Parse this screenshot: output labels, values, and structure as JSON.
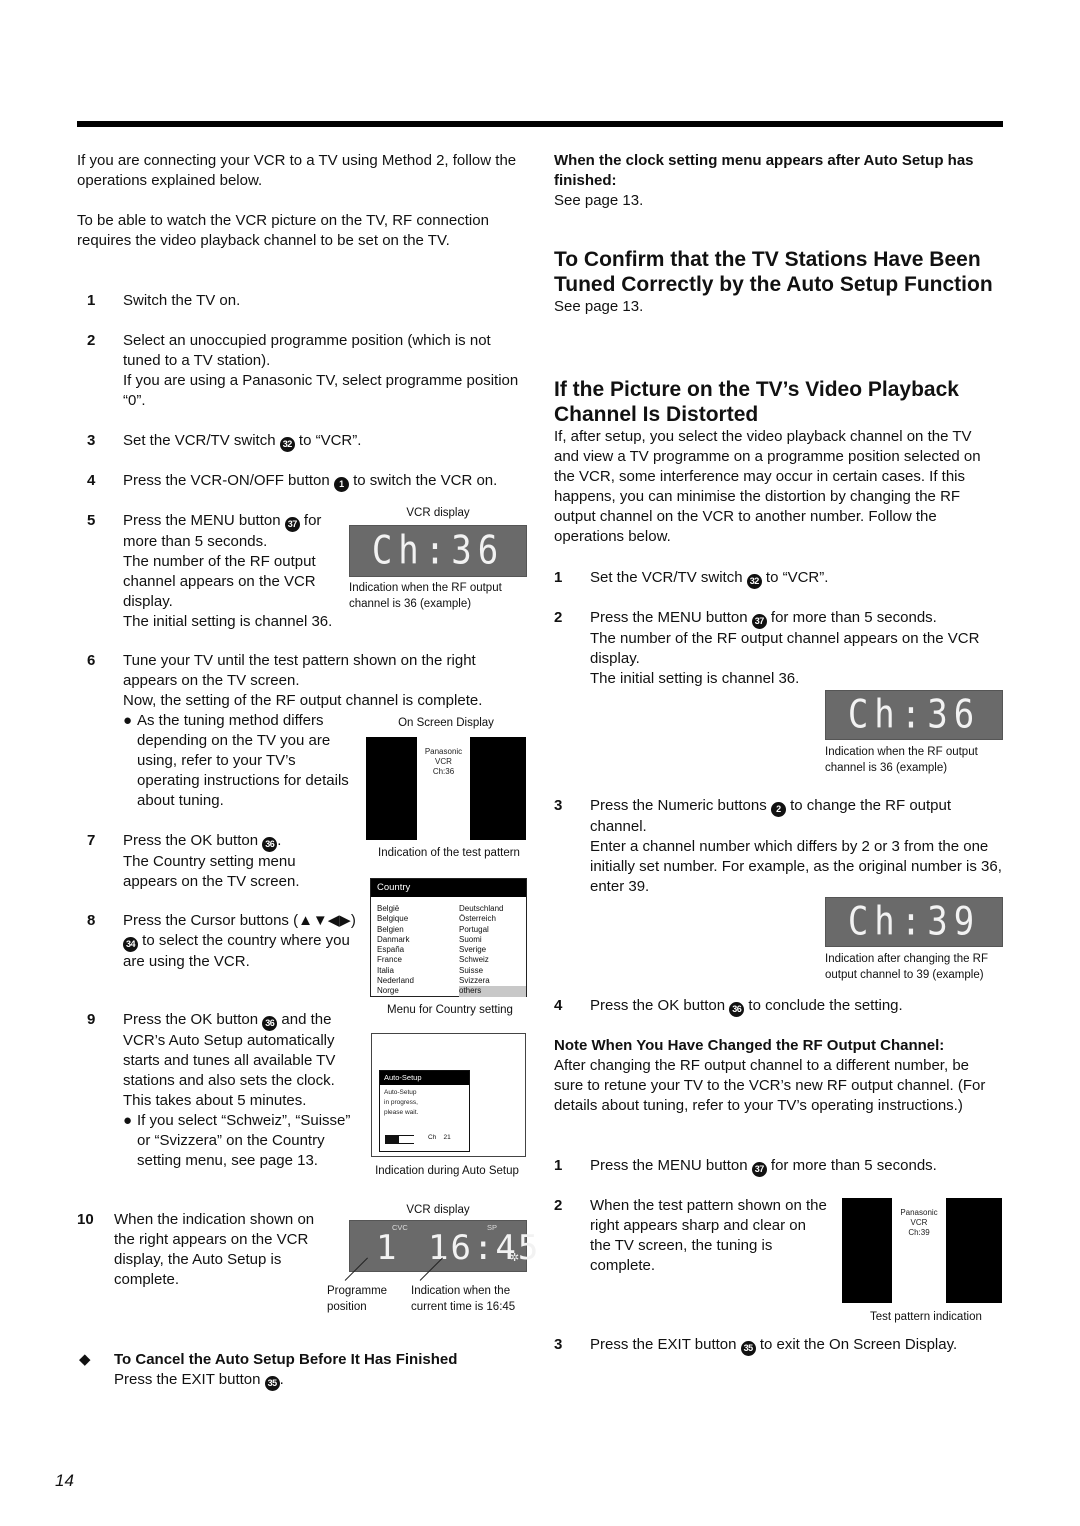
{
  "page_number": "14",
  "left": {
    "intro1": "If you are connecting your VCR to a TV using Method 2, follow the operations explained below.",
    "intro2": "To be able to watch the VCR picture on the TV, RF connection requires the video playback channel to be set on the TV.",
    "steps": [
      {
        "num": "1",
        "text": "Switch the TV on."
      },
      {
        "num": "2",
        "text": "Select an unoccupied programme position (which is not tuned to a TV station).",
        "text2": "If you are using a Panasonic TV, select programme position “0”."
      },
      {
        "num": "3",
        "pre": "Set the VCR/TV switch",
        "badge": "32",
        "post": "to “VCR”."
      },
      {
        "num": "4",
        "pre": "Press the VCR-ON/OFF button",
        "badge": "1",
        "post": "to switch the VCR on."
      },
      {
        "num": "5",
        "pre": "Press the MENU button",
        "badge": "37",
        "post": "for more than 5 seconds.",
        "text2": "The number of the RF output channel appears on the VCR display.",
        "text3": "The initial setting is channel 36."
      },
      {
        "num": "6",
        "text": "Tune your TV until the test pattern shown on the right appears on the TV screen.",
        "text2": "Now, the setting of the RF output channel is complete.",
        "bullet": "As the tuning method differs depending on the TV you are using, refer to your TV’s operating instructions for details about tuning."
      },
      {
        "num": "7",
        "pre": "Press the OK button",
        "badge": "36",
        "post": ".",
        "text2": "The Country setting menu appears on the TV screen."
      },
      {
        "num": "8",
        "pre": "Press the Cursor buttons (▲▼◀▶)",
        "badge": "34",
        "post": "to select the country where you are using the VCR."
      },
      {
        "num": "9",
        "pre": "Press the OK button",
        "badge": "36",
        "post": "and the VCR’s Auto Setup automatically starts and tunes all available TV stations and also sets the clock.",
        "text2": "This takes about 5 minutes.",
        "bullet": "If you select “Schweiz”, “Suisse” or “Svizzera” on the Country setting menu, see page 13."
      },
      {
        "num": "10",
        "text": "When the indication shown on the right appears on the VCR display, the Auto Setup is complete."
      }
    ],
    "cancel_heading": "To Cancel the Auto Setup Before It Has Finished",
    "cancel_pre": "Press the EXIT button",
    "cancel_badge": "35",
    "cancel_post": "."
  },
  "figures": {
    "vcr1": {
      "label": "VCR display",
      "display": "Ch:36",
      "caption1": "Indication when the RF output",
      "caption2": "channel is 36 (example)"
    },
    "osd": {
      "label": "On Screen Display",
      "lines": [
        "Panasonic",
        "VCR",
        "Ch:36"
      ],
      "caption": "Indication of the test pattern"
    },
    "country_menu": {
      "title": "Country",
      "col1": [
        "België",
        "Belgique",
        "Belgien",
        "Danmark",
        "España",
        "France",
        "Italia",
        "Nederland",
        "Norge"
      ],
      "col2": [
        "Deutschland",
        "Österreich",
        "Portugal",
        "Suomi",
        "Sverige",
        "Schweiz",
        "Suisse",
        "Svizzera",
        "others"
      ],
      "selected": "others",
      "caption": "Menu for Country setting"
    },
    "auto_setup": {
      "title": "Auto-Setup",
      "lines": [
        "Auto-Setup",
        "in progress,",
        "please wait."
      ],
      "ch_label": "Ch",
      "ch_value": "21",
      "progress": 0.45,
      "caption": "Indication during Auto Setup"
    },
    "vcr2": {
      "label": "VCR display",
      "cvc": "CVC",
      "sp": "SP",
      "programme": "1",
      "time": "16:45",
      "caption_left1": "Programme",
      "caption_left2": "position",
      "caption_right1": "Indication when the",
      "caption_right2": "current time is 16:45"
    },
    "vcr3": {
      "display": "Ch:36",
      "caption1": "Indication when the RF output",
      "caption2": "channel is 36 (example)"
    },
    "vcr4": {
      "display": "Ch:39",
      "caption1": "Indication after changing the RF",
      "caption2": "output channel to 39 (example)"
    },
    "test_pattern": {
      "lines": [
        "Panasonic",
        "VCR",
        "Ch:39"
      ],
      "caption": "Test pattern indication"
    }
  },
  "right": {
    "clock_heading": "When the clock setting menu appears after Auto Setup has finished:",
    "clock_see": "See page 13.",
    "confirm_heading": "To Confirm that the TV Stations Have Been Tuned Correctly by the Auto Setup Function",
    "confirm_see": "See page 13.",
    "distort_heading": "If the Picture on the TV’s Video Playback Channel Is Distorted",
    "distort_body": "If, after setup, you select the video playback channel on the TV and view a TV programme on a programme position selected on the VCR, some interference may occur in certain cases. If this happens, you can minimise the distortion by changing the RF output channel on the VCR to another number. Follow the operations below.",
    "steps": [
      {
        "num": "1",
        "pre": "Set the VCR/TV switch",
        "badge": "32",
        "post": "to “VCR”."
      },
      {
        "num": "2",
        "pre": "Press the MENU button",
        "badge": "37",
        "post": "for more than 5 seconds.",
        "text2": "The number of the RF output channel appears on the VCR display.",
        "text3": "The initial setting is channel 36."
      },
      {
        "num": "3",
        "pre": "Press the Numeric buttons",
        "badge": "2",
        "post": "to change the RF output channel.",
        "text2": "Enter a channel number which differs by 2 or 3 from the one initially set number. For example, as the original number is 36, enter 39."
      },
      {
        "num": "4",
        "pre": "Press the OK button",
        "badge": "36",
        "post": "to conclude the setting."
      }
    ],
    "note_heading": "Note When You Have Changed the RF Output Channel:",
    "note_body": "After changing the RF output channel to a different number, be sure to retune your TV to the VCR’s new RF output channel. (For details about tuning, refer to your TV’s operating instructions.)",
    "note_steps": [
      {
        "num": "1",
        "pre": "Press the MENU button",
        "badge": "37",
        "post": "for more than 5 seconds."
      },
      {
        "num": "2",
        "text": "When the test pattern shown on the right appears sharp and clear on the TV screen, the tuning is complete."
      },
      {
        "num": "3",
        "pre": "Press the EXIT button",
        "badge": "35",
        "post": "to exit the On Screen Display."
      }
    ]
  }
}
